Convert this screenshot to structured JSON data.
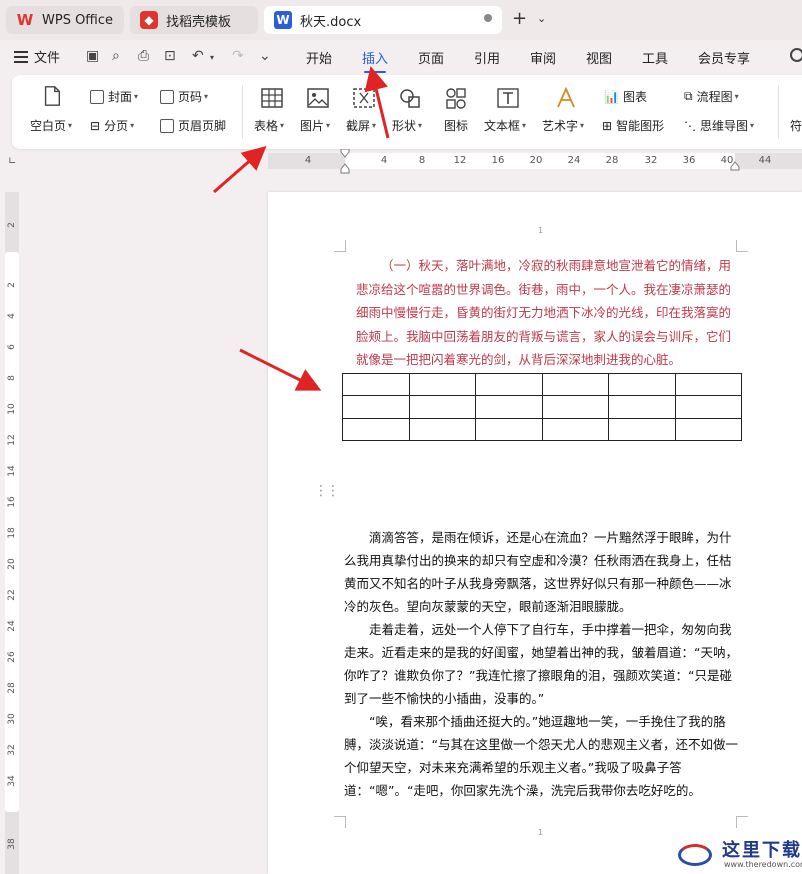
{
  "tabs": [
    {
      "label": "WPS Office",
      "icon": "wps-logo-icon",
      "color": "#e0342f"
    },
    {
      "label": "找稻壳模板",
      "icon": "docer-icon",
      "color": "#e0342f"
    },
    {
      "label": "秋天.docx",
      "icon": "word-doc-icon",
      "color": "#2b5fd9"
    }
  ],
  "menu": {
    "file": "文件",
    "tabs": [
      "开始",
      "插入",
      "页面",
      "引用",
      "审阅",
      "视图",
      "工具",
      "会员专享"
    ],
    "active": "插入"
  },
  "ribbon": {
    "blank_page": "空白页",
    "cover": "封面",
    "page_break": "分页",
    "page_number": "页码",
    "header_footer": "页眉页脚",
    "table": "表格",
    "picture": "图片",
    "screenshot": "截屏",
    "shape": "形状",
    "icon": "图标",
    "textbox": "文本框",
    "wordart": "艺术字",
    "chart": "图表",
    "smart_graphic": "智能图形",
    "flowchart": "流程图",
    "mindmap": "思维导图",
    "symbol": "符"
  },
  "ruler": {
    "h": [
      "4",
      "4",
      "8",
      "12",
      "16",
      "20",
      "24",
      "28",
      "32",
      "36",
      "40",
      "44"
    ],
    "v": [
      "2",
      "2",
      "4",
      "6",
      "8",
      "10",
      "12",
      "14",
      "16",
      "18",
      "20",
      "22",
      "24",
      "26",
      "28",
      "30",
      "32",
      "34",
      "38"
    ]
  },
  "page": {
    "page_num_top": "1",
    "page_num_bottom": "1",
    "red_paragraph": "（一）秋天，落叶满地，冷寂的秋雨肆意地宣泄着它的情绪，用悲凉给这个喧嚣的世界调色。街巷，雨中，一个人。我在凄凉萧瑟的细雨中慢慢行走，昏黄的街灯无力地洒下冰冷的光线，印在我落寞的脸颊上。我脑中回荡着朋友的背叛与谎言，家人的误会与训斥，它们就像是一把把闪着寒光的剑，从背后深深地刺进我的心脏。",
    "table": {
      "rows": 3,
      "cols": 6
    },
    "paragraphs": [
      "滴滴答答，是雨在倾诉，还是心在流血？一片黯然浮于眼眸，为什么我用真挚付出的换来的却只有空虚和冷漠？任秋雨洒在我身上，任枯黄而又不知名的叶子从我身旁飘落，这世界好似只有那一种颜色——冰冷的灰色。望向灰蒙蒙的天空，眼前逐渐泪眼朦胧。",
      "走着走着，远处一个人停下了自行车，手中撑着一把伞，匆匆向我走来。近看走来的是我的好闺蜜，她望着出神的我，皱着眉道：“天呐，你咋了？谁欺负你了？”我连忙擦了擦眼角的泪，强颜欢笑道：“只是碰到了一些不愉快的小插曲，没事的。”",
      "“唉，看来那个插曲还挺大的。”她逗趣地一笑，一手挽住了我的胳膊，淡淡说道：“与其在这里做一个怨天尤人的悲观主义者，还不如做一个仰望天空，对未来充满希望的乐观主义者。”我吸了吸鼻子答道：“嗯”。“走吧，你回家先洗个澡，洗完后我带你去吃好吃的。"
    ]
  },
  "watermark": {
    "title": "这里下载",
    "url": "www.theredown.com"
  },
  "colors": {
    "accent": "#2b5fd9",
    "annotation": "#e02424",
    "red_text": "#c0394b"
  }
}
